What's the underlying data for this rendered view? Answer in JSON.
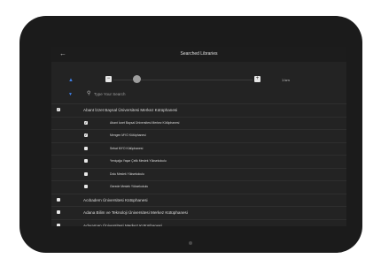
{
  "app": {
    "title": "Searched Libraries"
  },
  "controls": {
    "font_size_label": "1 krn",
    "search_placeholder": "Type Your Search"
  },
  "libraries": [
    {
      "label": "Abant İzzet Baysal Üniversitesi Merkez Kütüphanesi",
      "checked": true,
      "level": 0
    },
    {
      "label": "Abant İzzet Baysal Üniversitesi Merkez Kütüphanesi",
      "checked": true,
      "level": 1
    },
    {
      "label": "Mengen MYO Kütüphanesi",
      "checked": true,
      "level": 1
    },
    {
      "label": "Sebat MYO Kütüphanesi",
      "checked": false,
      "level": 1
    },
    {
      "label": "Yeniçağa Yaşar Çelik Meslek Yüksekokulu",
      "checked": false,
      "level": 1
    },
    {
      "label": "Dolu Meslek Yüksekokulu",
      "checked": false,
      "level": 1
    },
    {
      "label": "Gerede Meslek Yüksekokulu",
      "checked": false,
      "level": 1
    },
    {
      "label": "Acıbadem Üniversitesi Kütüphanesi",
      "checked": false,
      "level": 0
    },
    {
      "label": "Adana Bilim ve Teknoloji Üniversitesi Merkez Kütüphanesi",
      "checked": false,
      "level": 0
    },
    {
      "label": "Adıyaman Üniversitesi Merkez Kütüphanesi",
      "checked": false,
      "level": 0
    }
  ]
}
